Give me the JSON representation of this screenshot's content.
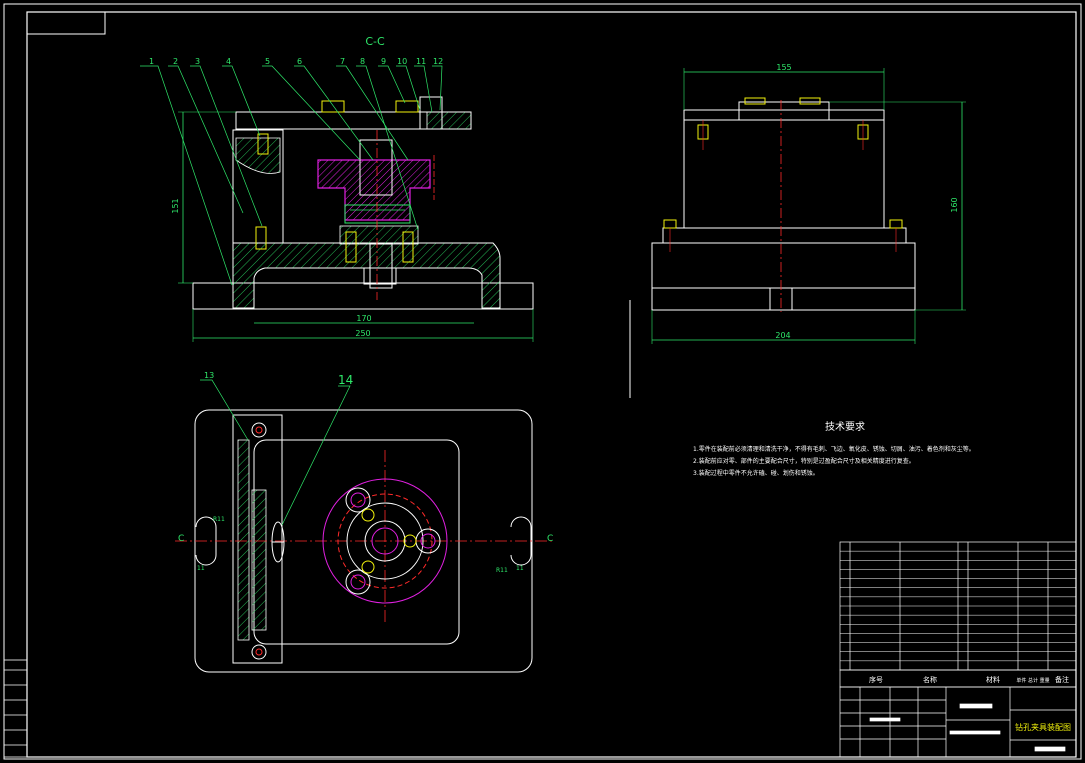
{
  "colors": {
    "background": "#000000",
    "frame": "#ffffff",
    "dimension": "#2ee86a",
    "hatch": "#2ee86a",
    "magenta": "#e020e0",
    "red": "#ff2a2a",
    "yellow": "#f2f20c",
    "cyan": "#19e6e6"
  },
  "section_label": "C-C",
  "part_callouts": [
    "1",
    "2",
    "3",
    "4",
    "5",
    "6",
    "7",
    "8",
    "9",
    "10",
    "11",
    "12"
  ],
  "plan_callouts": [
    "13",
    "14"
  ],
  "dimensions": {
    "front_height": "151",
    "front_inner_width": "170",
    "front_total_width": "250",
    "side_top_width": "155",
    "side_height": "160",
    "side_bottom_width": "204",
    "r11_a": "R11",
    "r11_b": "R11",
    "dim_11_a": "11",
    "dim_11_b": "11",
    "c_left": "C",
    "c_right": "C"
  },
  "tech_requirements": {
    "title": "技术要求",
    "items": [
      "1.零件在装配前必须清理和清洗干净，不得有毛刺、飞边、氧化皮、锈蚀、切屑、油污、着色剂和灰尘等。",
      "2.装配前应对零、部件的主要配合尺寸，特别是过盈配合尺寸及相关精度进行复查。",
      "3.装配过程中零件不允许磕、碰、划伤和锈蚀。"
    ]
  },
  "bom_header": {
    "seq": "序号",
    "name": "名称",
    "material": "材料",
    "weight": "单件 总计 重量",
    "remark": "备注"
  },
  "title_block": {
    "drawing_title": "钻孔夹具装配图"
  }
}
